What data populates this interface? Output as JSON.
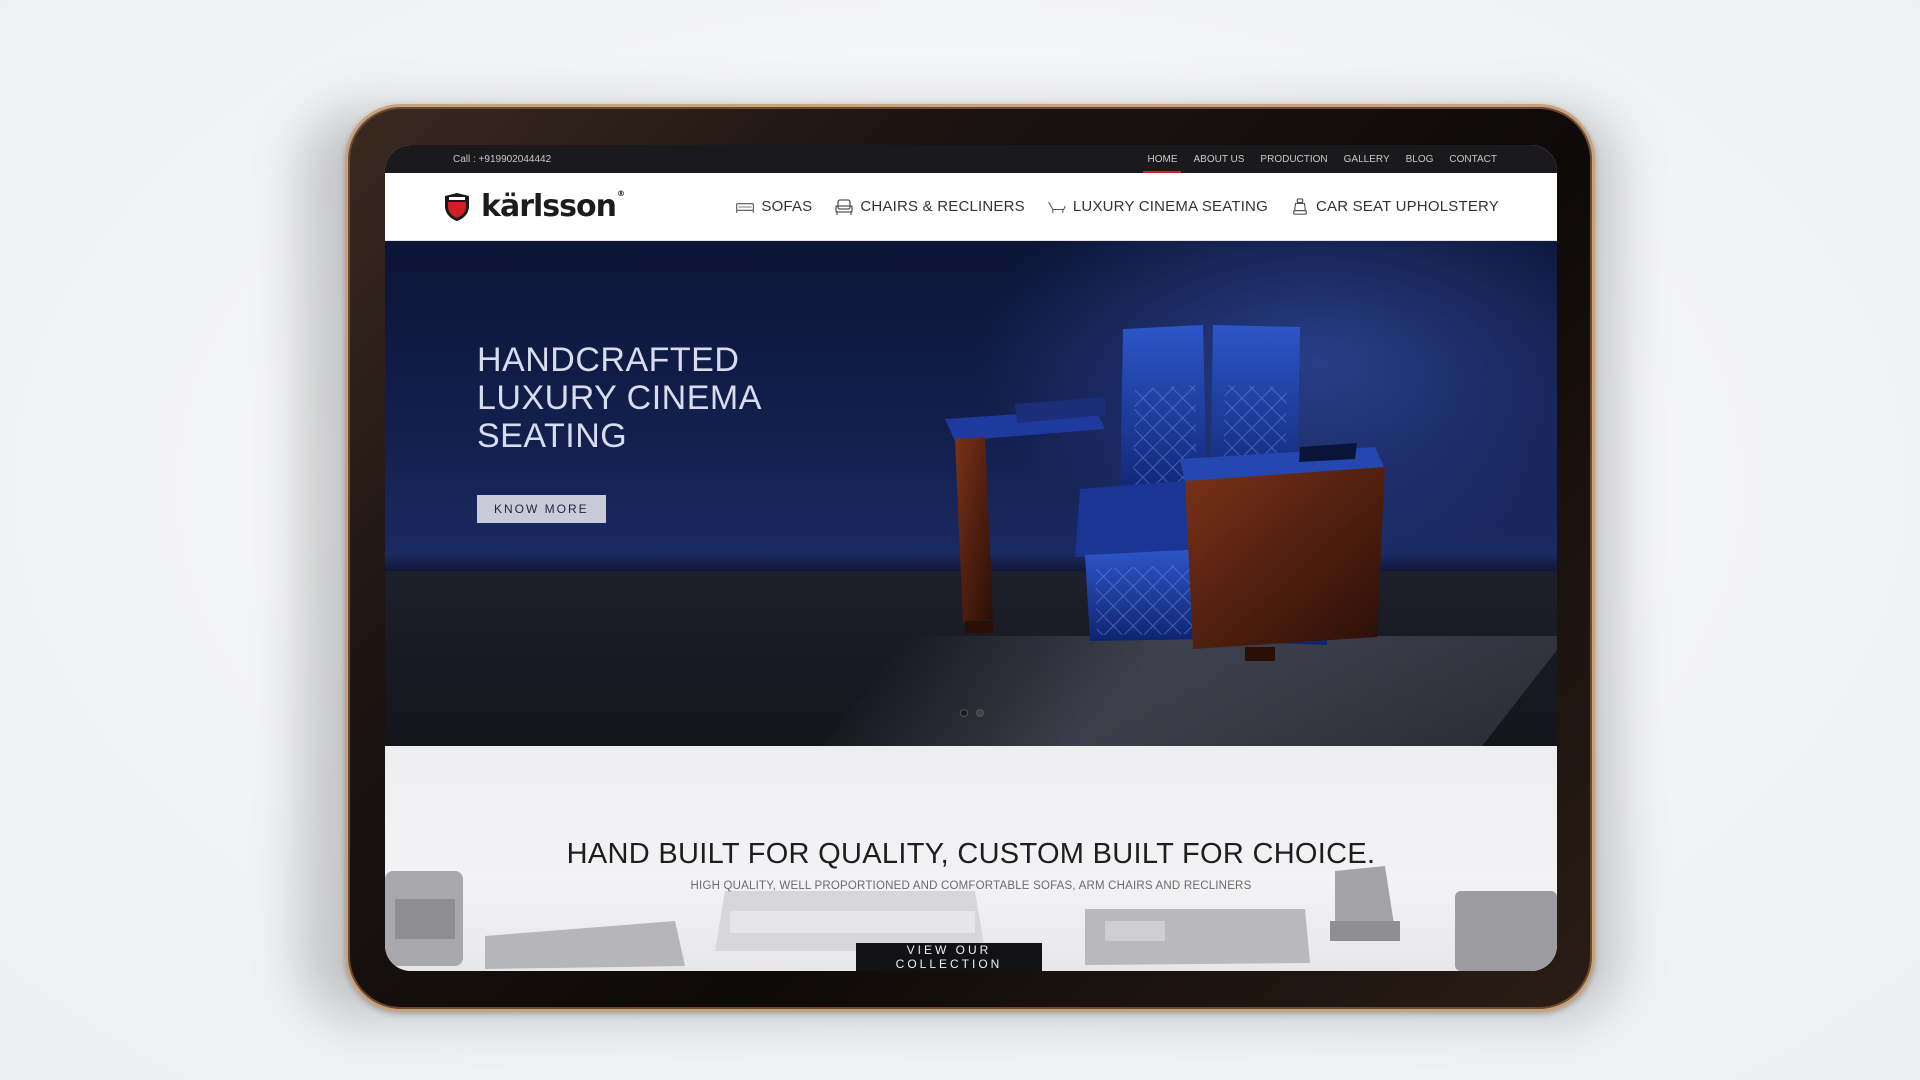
{
  "topbar": {
    "call": "Call : +919902044442",
    "links": [
      "HOME",
      "ABOUT US",
      "PRODUCTION",
      "GALLERY",
      "BLOG",
      "CONTACT"
    ],
    "active_link": "HOME"
  },
  "brand": {
    "name": "kärlsson",
    "reg": "®"
  },
  "nav": {
    "items": [
      {
        "label": "SOFAS",
        "icon": "sofa-icon"
      },
      {
        "label": "CHAIRS & RECLINERS",
        "icon": "armchair-icon"
      },
      {
        "label": "LUXURY CINEMA SEATING",
        "icon": "recliner-icon"
      },
      {
        "label": "CAR SEAT UPHOLSTERY",
        "icon": "car-seat-icon"
      }
    ]
  },
  "hero": {
    "title_lines": [
      "HANDCRAFTED",
      "LUXURY CINEMA",
      "SEATING"
    ],
    "button": "KNOW MORE",
    "slides": 2,
    "active_slide": 1
  },
  "lower": {
    "title": "HAND BUILT FOR QUALITY, CUSTOM BUILT FOR CHOICE.",
    "subtitle": "HIGH QUALITY, WELL PROPORTIONED AND COMFORTABLE SOFAS, ARM CHAIRS AND RECLINERS",
    "button": "VIEW OUR COLLECTION"
  },
  "colors": {
    "accent": "#d21f26",
    "hero_bg": "#13204f",
    "chair_leather": "#1f3f9e",
    "wood": "#5a2414"
  }
}
